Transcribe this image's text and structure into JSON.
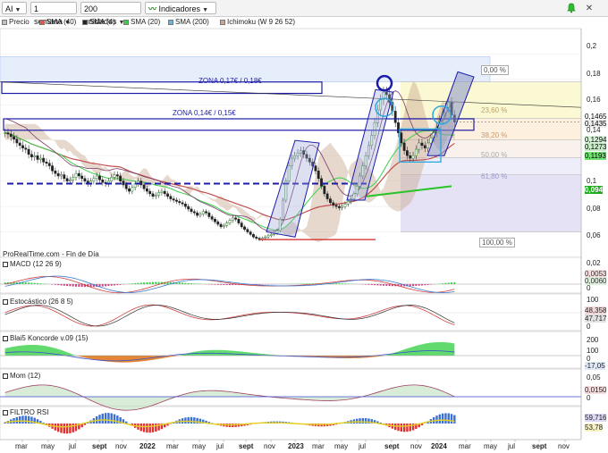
{
  "toolbar": {
    "symbol": "AI",
    "period": "1 semana",
    "units": "200 unidades",
    "indicators_label": "Indicadores"
  },
  "legend": [
    {
      "label": "Precio",
      "color": "#c0c0c0"
    },
    {
      "label": "SMA (40)",
      "color": "#e8524a"
    },
    {
      "label": "SMA (4)",
      "color": "#222222"
    },
    {
      "label": "SMA (20)",
      "color": "#3bd14a"
    },
    {
      "label": "SMA (200)",
      "color": "#6fb3e0"
    },
    {
      "label": "Ichimoku (W 9 26 52)",
      "color": "#c8a890"
    }
  ],
  "colors": {
    "up": "#2a7a2a",
    "down": "#222222",
    "zone_blue": "#1c1ca8",
    "resist_red": "#d42020",
    "sma40": "#c0504d",
    "sma20": "#3bd14a",
    "sma200": "#6fb3e0",
    "ichimoku_fill": "#c8a890",
    "green_support": "#28c428",
    "last_price": "#555555"
  },
  "main_panel": {
    "watermark": "ProRealTime.com - Fin de Día",
    "zone_label_1": "ZONA 0,17€ / 0,18€",
    "zone_label_2": "ZONA 0,14€ / 0,15€",
    "y_ticks": [
      "0,2",
      "0,18",
      "0,16",
      "0,1465",
      "0,1435",
      "0,14",
      "0,1294",
      "0,1273",
      "0,1193",
      "0,1",
      "0,094",
      "0,08",
      "0,06"
    ],
    "fib_levels": [
      {
        "label": "0,00 %",
        "value": 0.178
      },
      {
        "label": "23,60 %",
        "value": 0.1495
      },
      {
        "label": "38,20 %",
        "value": 0.1325
      },
      {
        "label": "50,00 %",
        "value": 0.1185
      },
      {
        "label": "61,80 %",
        "value": 0.105
      },
      {
        "label": "100,00 %",
        "value": 0.06
      }
    ],
    "current_price": "0,1465"
  },
  "panels": [
    {
      "title": "MACD (12 26 9)",
      "values": [
        "0,02",
        "0,0053",
        "0,0060",
        "0"
      ]
    },
    {
      "title": "Estocástico (26 8 5)",
      "values": [
        "100",
        "48,358",
        "47,717",
        "0"
      ]
    },
    {
      "title": "Blai5 Koncorde v.09 (15)",
      "values": [
        "200",
        "100",
        "0",
        "-17,05"
      ]
    },
    {
      "title": "Mom (12)",
      "values": [
        "0,05",
        "0,0150",
        "0"
      ]
    },
    {
      "title": "FILTRO RSI",
      "values": [
        "59,716",
        "53,78"
      ]
    }
  ],
  "x_axis": [
    "mar",
    "may",
    "jul",
    "sept",
    "nov",
    "2022",
    "mar",
    "may",
    "jul",
    "sept",
    "nov",
    "2023",
    "mar",
    "may",
    "jul",
    "sept",
    "nov",
    "2024",
    "mar",
    "may",
    "jul",
    "sept",
    "nov"
  ],
  "chart_data": {
    "type": "candlestick",
    "frequency": "weekly",
    "y_range": [
      0.04,
      0.22
    ],
    "series": [
      {
        "name": "Precio",
        "values": [
          0.138,
          0.137,
          0.135,
          0.133,
          0.13,
          0.128,
          0.126,
          0.125,
          0.121,
          0.119,
          0.12,
          0.117,
          0.118,
          0.115,
          0.114,
          0.112,
          0.108,
          0.106,
          0.104,
          0.105,
          0.102,
          0.1,
          0.101,
          0.103,
          0.106,
          0.104,
          0.102,
          0.1,
          0.098,
          0.1,
          0.102,
          0.104,
          0.101,
          0.099,
          0.098,
          0.1,
          0.103,
          0.105,
          0.104,
          0.1,
          0.097,
          0.094,
          0.092,
          0.095,
          0.098,
          0.1,
          0.097,
          0.094,
          0.092,
          0.09,
          0.088,
          0.089,
          0.091,
          0.092,
          0.09,
          0.088,
          0.086,
          0.085,
          0.084,
          0.083,
          0.082,
          0.08,
          0.078,
          0.076,
          0.075,
          0.073,
          0.074,
          0.076,
          0.075,
          0.072,
          0.07,
          0.068,
          0.066,
          0.064,
          0.065,
          0.067,
          0.069,
          0.071,
          0.07,
          0.067,
          0.064,
          0.062,
          0.06,
          0.058,
          0.056,
          0.055,
          0.054,
          0.055,
          0.056,
          0.057,
          0.058,
          0.059,
          0.061,
          0.07,
          0.085,
          0.1,
          0.112,
          0.118,
          0.12,
          0.122,
          0.124,
          0.121,
          0.118,
          0.115,
          0.112,
          0.108,
          0.102,
          0.096,
          0.09,
          0.086,
          0.083,
          0.081,
          0.08,
          0.079,
          0.08,
          0.082,
          0.084,
          0.086,
          0.09,
          0.096,
          0.104,
          0.112,
          0.12,
          0.128,
          0.136,
          0.146,
          0.156,
          0.164,
          0.17,
          0.168,
          0.162,
          0.155,
          0.146,
          0.138,
          0.13,
          0.124,
          0.12,
          0.118,
          0.12,
          0.125,
          0.13,
          0.128,
          0.126,
          0.13,
          0.134,
          0.138,
          0.142,
          0.148,
          0.154,
          0.158,
          0.162,
          0.152,
          0.1465
        ]
      }
    ]
  }
}
